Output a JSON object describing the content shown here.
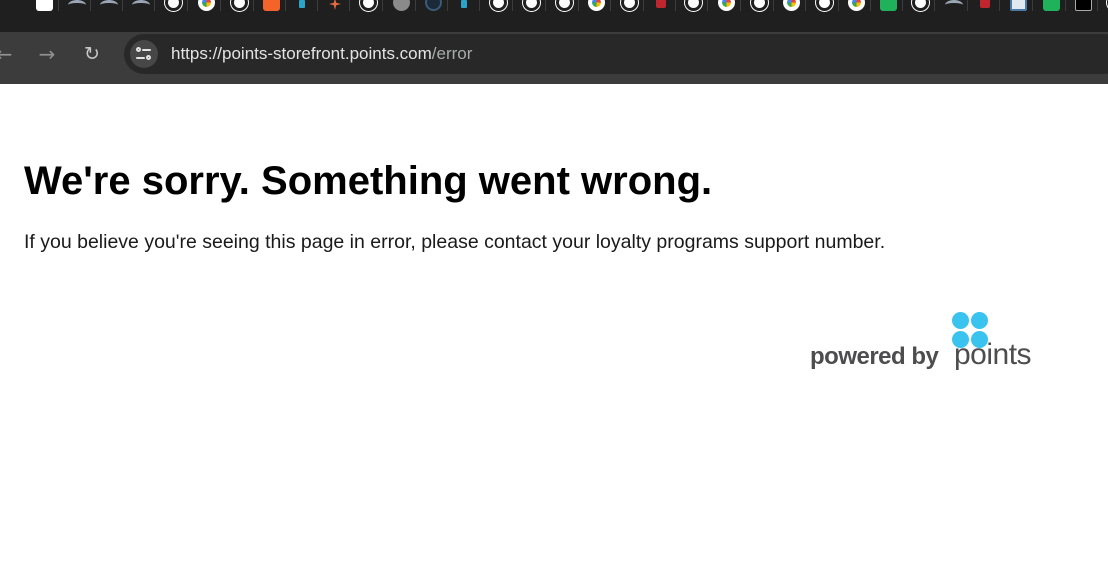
{
  "browser": {
    "tabs": [
      {
        "icon": "chatgpt-icon"
      },
      {
        "icon": "arrow-icon"
      },
      {
        "icon": "arrow-icon"
      },
      {
        "icon": "arrow-icon"
      },
      {
        "icon": "github-icon"
      },
      {
        "icon": "google-icon"
      },
      {
        "icon": "github-icon"
      },
      {
        "icon": "brave-icon"
      },
      {
        "icon": "slack-icon"
      },
      {
        "icon": "claude-icon"
      },
      {
        "icon": "github-icon"
      },
      {
        "icon": "ring-icon"
      },
      {
        "icon": "dark-globe-icon"
      },
      {
        "icon": "slack-icon"
      },
      {
        "icon": "github-icon"
      },
      {
        "icon": "github-icon"
      },
      {
        "icon": "github-icon"
      },
      {
        "icon": "google-icon"
      },
      {
        "icon": "github-icon"
      },
      {
        "icon": "red-icon"
      },
      {
        "icon": "github-icon"
      },
      {
        "icon": "google-icon"
      },
      {
        "icon": "github-icon"
      },
      {
        "icon": "google-icon"
      },
      {
        "icon": "github-icon"
      },
      {
        "icon": "google-icon"
      },
      {
        "icon": "green-g-icon"
      },
      {
        "icon": "github-icon"
      },
      {
        "icon": "arrow-icon"
      },
      {
        "icon": "red-dot-icon"
      },
      {
        "icon": "document-icon"
      },
      {
        "icon": "green-g-icon"
      },
      {
        "icon": "x-icon"
      },
      {
        "icon": "github-icon"
      }
    ],
    "url": {
      "host": "https://points-storefront.points.com",
      "path": "/error"
    }
  },
  "page": {
    "title": "We're sorry. Something went wrong.",
    "message": "If you believe you're seeing this page in error, please contact your loyalty programs support number.",
    "footer": {
      "powered_by": "powered by",
      "brand": "points",
      "brand_color": "#3bc3ef",
      "text_color": "#4d4d4f"
    }
  }
}
